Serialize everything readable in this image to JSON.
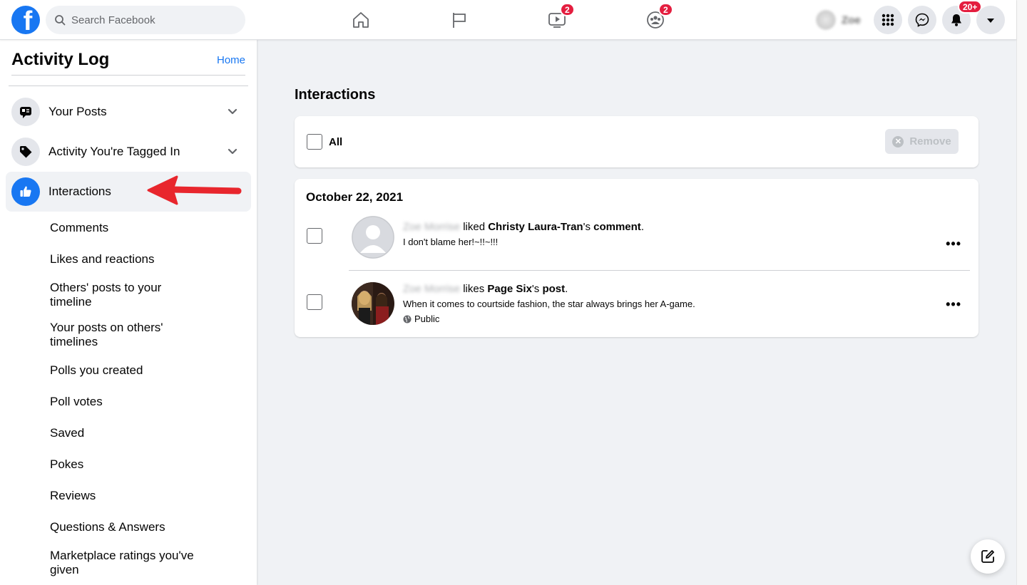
{
  "topbar": {
    "logo_letter": "f",
    "search_placeholder": "Search Facebook",
    "watch_badge": "2",
    "groups_badge": "2",
    "profile_name": "Zoe",
    "notifications_badge": "20+"
  },
  "sidebar": {
    "title": "Activity Log",
    "home_link": "Home",
    "items": [
      {
        "label": "Your Posts"
      },
      {
        "label": "Activity You're Tagged In"
      },
      {
        "label": "Interactions"
      }
    ],
    "subitems": [
      "Comments",
      "Likes and reactions",
      "Others' posts to your timeline",
      "Your posts on others' timelines",
      "Polls you created",
      "Poll votes",
      "Saved",
      "Pokes",
      "Reviews",
      "Questions & Answers",
      "Marketplace ratings you've given"
    ]
  },
  "main": {
    "title": "Interactions",
    "select_all_label": "All",
    "remove_label": "Remove",
    "date": "October 22, 2021",
    "entries": [
      {
        "actor": "Zoe Morrise",
        "verb": " liked ",
        "target": "Christy Laura-Tran",
        "possessive": "'s ",
        "object": "comment",
        "end": ".",
        "snippet": "I don't blame her!~!!~!!!"
      },
      {
        "actor": "Zoe Morrise",
        "verb": " likes ",
        "target": "Page Six",
        "possessive": "'s ",
        "object": "post",
        "end": ".",
        "snippet": "When it comes to courtside fashion, the star always brings her A-game.",
        "privacy": "Public"
      }
    ]
  },
  "colors": {
    "brand": "#1877f2",
    "badge": "#e41e3f",
    "arrow": "#e8262d"
  }
}
